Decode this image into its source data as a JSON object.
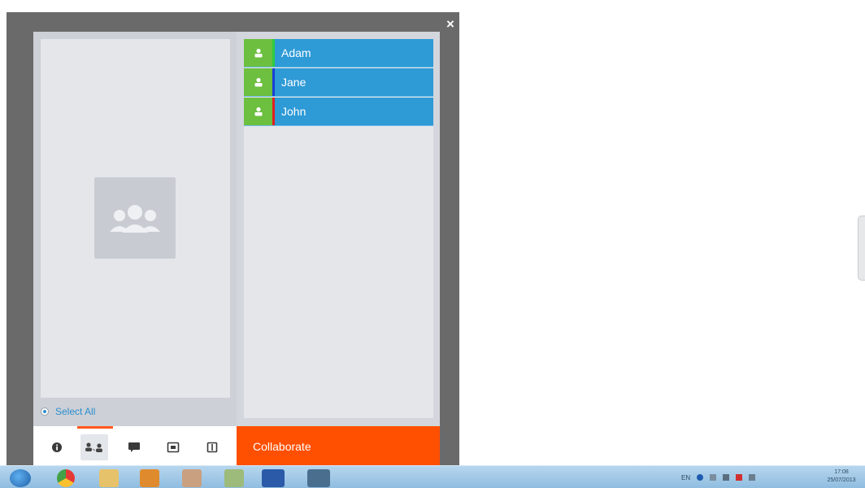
{
  "window": {
    "close_symbol": "×"
  },
  "left_panel": {
    "empty_state_icon": "group-icon",
    "select_all_label": "Select All"
  },
  "toolbar": {
    "buttons": [
      {
        "icon": "info-icon",
        "active": false
      },
      {
        "icon": "participants-icon",
        "active": true
      },
      {
        "icon": "chat-icon",
        "active": false
      },
      {
        "icon": "screen-share-icon",
        "active": false
      },
      {
        "icon": "pause-icon",
        "active": false
      }
    ]
  },
  "participants": [
    {
      "name": "Adam",
      "stripe_color": "#2ecc40"
    },
    {
      "name": "Jane",
      "stripe_color": "#1a3fd6"
    },
    {
      "name": "John",
      "stripe_color": "#e02020"
    }
  ],
  "collaborate_label": "Collaborate",
  "colors": {
    "accent_orange": "#ff4f00",
    "participant_blue": "#2e9ad6",
    "avatar_green": "#6cbf3f",
    "frame_gray": "#6a6a6a"
  },
  "taskbar": {
    "apps": [
      "windows-start-icon",
      "chrome-icon",
      "folder-icon",
      "outlook-icon",
      "paint-icon",
      "notes-icon",
      "word-icon",
      "app-icon"
    ],
    "tray": {
      "language": "EN",
      "time": "17:08",
      "date": "25/07/2013"
    }
  }
}
